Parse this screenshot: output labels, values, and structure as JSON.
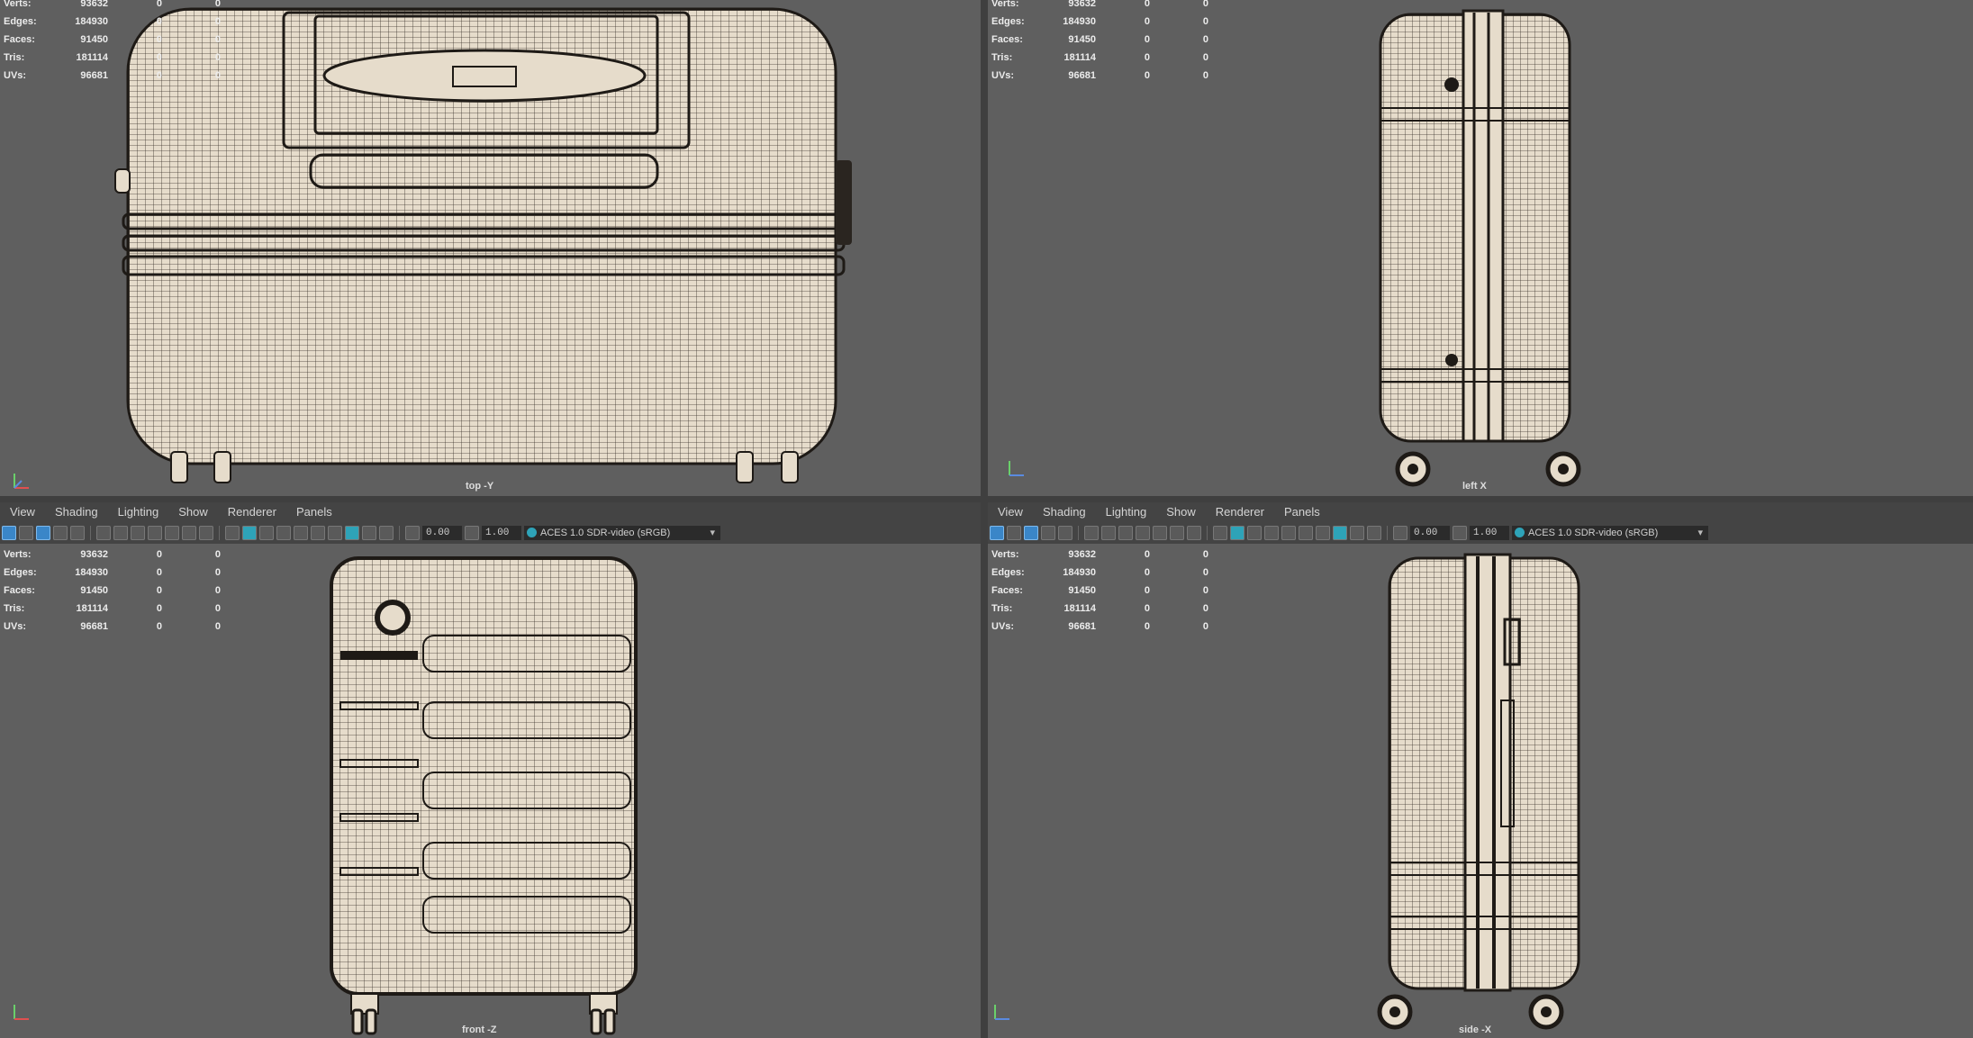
{
  "stats": {
    "labels": [
      "Verts:",
      "Edges:",
      "Faces:",
      "Tris:",
      "UVs:"
    ],
    "values": [
      "93632",
      "184930",
      "91450",
      "181114",
      "96681"
    ],
    "col2": [
      "0",
      "0",
      "0",
      "0",
      "0"
    ],
    "col3": [
      "0",
      "0",
      "0",
      "0",
      "0"
    ]
  },
  "viewports": {
    "top": {
      "camera": "top -Y"
    },
    "left": {
      "camera": "left X"
    },
    "front": {
      "camera": "front -Z"
    },
    "side": {
      "camera": "side -X"
    }
  },
  "panel_menu": [
    "View",
    "Shading",
    "Lighting",
    "Show",
    "Renderer",
    "Panels"
  ],
  "toolbar": {
    "exposure": "0.00",
    "gamma": "1.00",
    "color_space": "ACES 1.0 SDR-video (sRGB)"
  },
  "colors": {
    "viewport_bg": "#5f5f5f",
    "mesh_fill": "#e6dccb",
    "wire": "#2a2520"
  }
}
